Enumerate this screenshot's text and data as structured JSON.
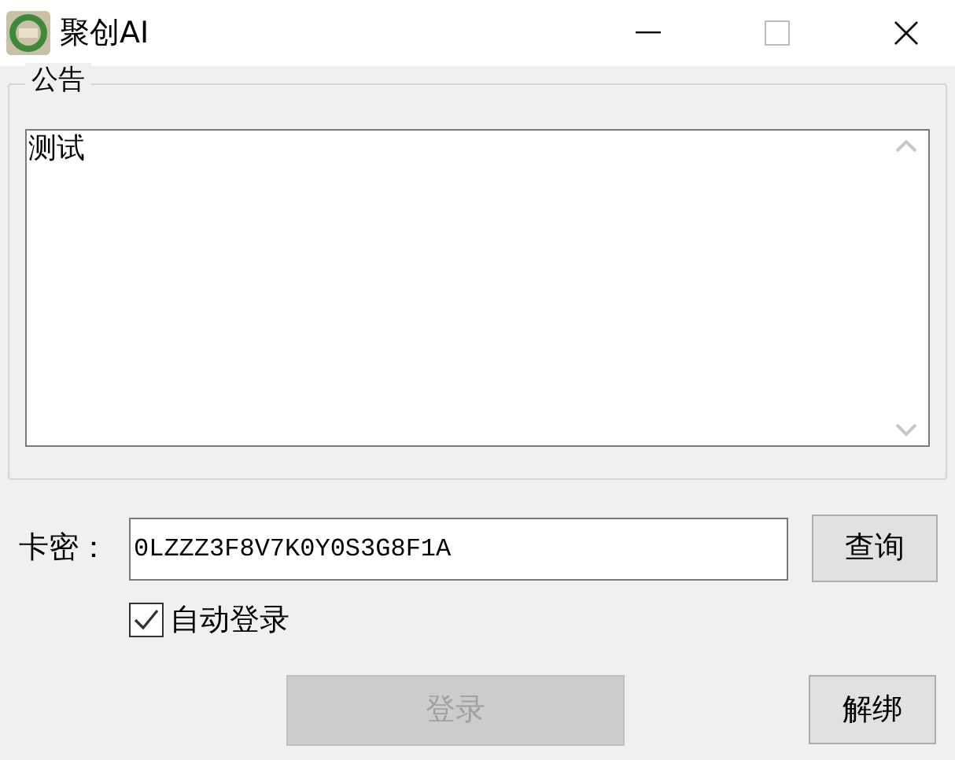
{
  "window": {
    "title": "聚创AI"
  },
  "notice": {
    "label": "公告",
    "text": "测试"
  },
  "card_key": {
    "label": "卡密：",
    "value": "0LZZZ3F8V7K0Y0S3G8F1A"
  },
  "query_button": {
    "label": "查询"
  },
  "auto_login": {
    "label": "自动登录",
    "checked": true
  },
  "login_button": {
    "label": "登录",
    "disabled": true
  },
  "unbind_button": {
    "label": "解绑"
  }
}
